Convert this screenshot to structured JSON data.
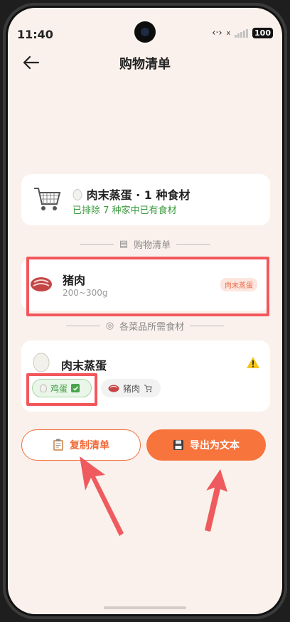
{
  "status": {
    "time": "11:40",
    "battery": "100",
    "sim": "x"
  },
  "header": {
    "title": "购物清单"
  },
  "summary": {
    "title": "肉末蒸蛋 · 1 种食材",
    "subtitle": "已排除 7 种家中已有食材"
  },
  "shopping_section": {
    "label": "购物清单"
  },
  "shopping_items": [
    {
      "name": "猪肉",
      "quantity": "200~300g",
      "tag": "肉末蒸蛋"
    }
  ],
  "dishes_section": {
    "label": "各菜品所需食材"
  },
  "dishes": [
    {
      "name": "肉末蒸蛋",
      "ingredients": [
        {
          "name": "鸡蛋",
          "status": "have"
        },
        {
          "name": "猪肉",
          "status": "buy"
        }
      ]
    }
  ],
  "buttons": {
    "copy": "复制清单",
    "export": "导出为文本"
  },
  "colors": {
    "accent": "#f7743d",
    "green": "#3a9a3c",
    "annotation_red": "#f1575b"
  },
  "icons": [
    "back-arrow-icon",
    "shopping-cart-icon",
    "egg-icon",
    "meat-icon",
    "clipboard-icon",
    "floppy-disk-icon",
    "warning-icon",
    "check-icon"
  ]
}
